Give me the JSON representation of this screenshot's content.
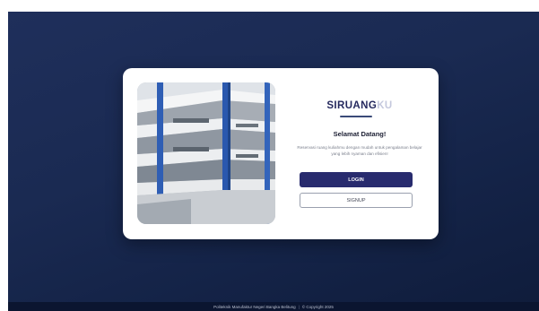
{
  "brand": {
    "main": "SIRUANG",
    "accent": "KU"
  },
  "welcome_title": "Selamat Datang!",
  "description": "Reservasi ruang kuliahmu dengan mudah untuk pengalaman belajar yang lebih nyaman dan efisien!",
  "buttons": {
    "login": "LOGIN",
    "signup": "SIGNUP"
  },
  "footer": {
    "institution": "Politeknik Manufaktur Negeri Bangka Belitung",
    "separator": "|",
    "copyright": "© Copyright 2025"
  },
  "colors": {
    "background": "#1a2a52",
    "primary_button": "#282b6e",
    "brand_text": "#25295e",
    "brand_accent": "#c4c8dd"
  }
}
